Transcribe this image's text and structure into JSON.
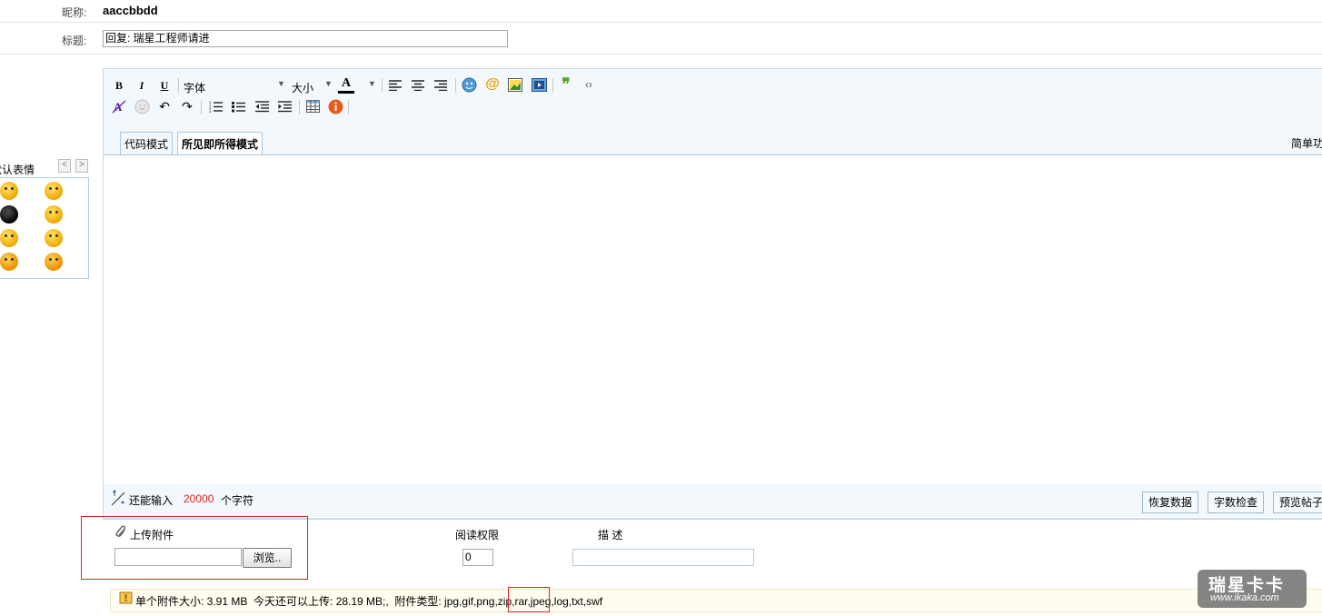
{
  "nickname": {
    "label": "昵称:",
    "value": "aaccbbdd"
  },
  "title": {
    "label": "标题:",
    "value": "回复: 瑞星工程师请进"
  },
  "toolbar": {
    "bold": "B",
    "italic": "I",
    "underline": "U",
    "font_label": "字体",
    "size_label": "大小",
    "forecolor": "A"
  },
  "tabs": {
    "code_mode": "代码模式",
    "wysiwyg_mode": "所见即所得模式",
    "simple_mode": "简单功"
  },
  "emoticons": {
    "title": "默认表情",
    "prev": "<",
    "next": ">"
  },
  "status": {
    "prefix": "还能输入",
    "remaining": "20000",
    "suffix": "个字符",
    "restore_button": "恢复数据",
    "wordcount_button": "字数检查",
    "preview_button": "预览帖子"
  },
  "attachment": {
    "upload_label": "上传附件",
    "browse_button": "浏览..",
    "read_perm_label": "阅读权限",
    "read_perm_value": "0",
    "desc_label": "描 述",
    "info_text": "单个附件大小: 3.91 MB  今天还可以上传: 28.19 MB;,  附件类型: jpg,gif,png,zip,rar,jpeg,log,txt,swf"
  },
  "watermark": {
    "brand": "瑞星卡卡",
    "url": "www.ikaka.com"
  },
  "colors": {
    "accent_border": "#c6dbe9",
    "toolbar_bg": "#f3f8fc",
    "remaining_red": "#d9261c",
    "highlight_red": "#d9261c"
  }
}
